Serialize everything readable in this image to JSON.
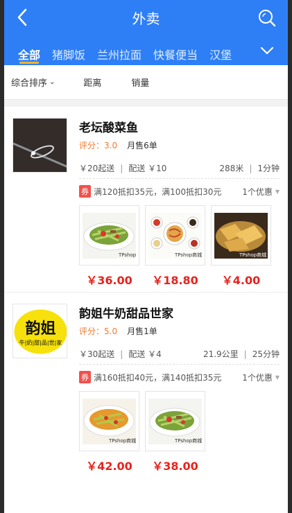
{
  "header": {
    "title": "外卖"
  },
  "tabs": [
    "全部",
    "猪脚饭",
    "兰州拉面",
    "快餐便当",
    "汉堡"
  ],
  "sort": [
    {
      "label": "综合排序",
      "caret": "⌄"
    },
    {
      "label": "距离"
    },
    {
      "label": "销量"
    }
  ],
  "shops": [
    {
      "name": "老坛酸菜鱼",
      "score": "评分：3.0",
      "monthly_sales": "月售6单",
      "min_order": "￥20起送",
      "delivery_fee": "配送 ￥10",
      "distance": "288米",
      "time": "1分钟",
      "coupon_tag": "券",
      "promo": "满120抵扣35元，满100抵扣30元",
      "promo_count": "1个优惠",
      "foods": [
        {
          "price": "￥36.00",
          "watermark": "TPshop商城"
        },
        {
          "price": "￥18.80",
          "watermark": "TPshop商城"
        },
        {
          "price": "￥4.00",
          "watermark": "TPshop商城"
        }
      ]
    },
    {
      "name": "韵姐牛奶甜品世家",
      "logo_text": "韵姐",
      "logo_sub": "牛|奶|甜|品|世|家",
      "score": "评分：5.0",
      "monthly_sales": "月售1单",
      "min_order": "￥30起送",
      "delivery_fee": "配送 ￥4",
      "distance": "21.9公里",
      "time": "25分钟",
      "coupon_tag": "券",
      "promo": "满160抵扣40元，满140抵扣35元",
      "promo_count": "1个优惠",
      "foods": [
        {
          "price": "￥42.00",
          "watermark": "TPshop商城"
        },
        {
          "price": "￥38.00",
          "watermark": "TPshop商城"
        }
      ]
    }
  ],
  "colors": {
    "brand": "#2e7ff6",
    "price": "#e8221d",
    "score": "#f2792b",
    "tab_indicator": "#ffb12b"
  }
}
